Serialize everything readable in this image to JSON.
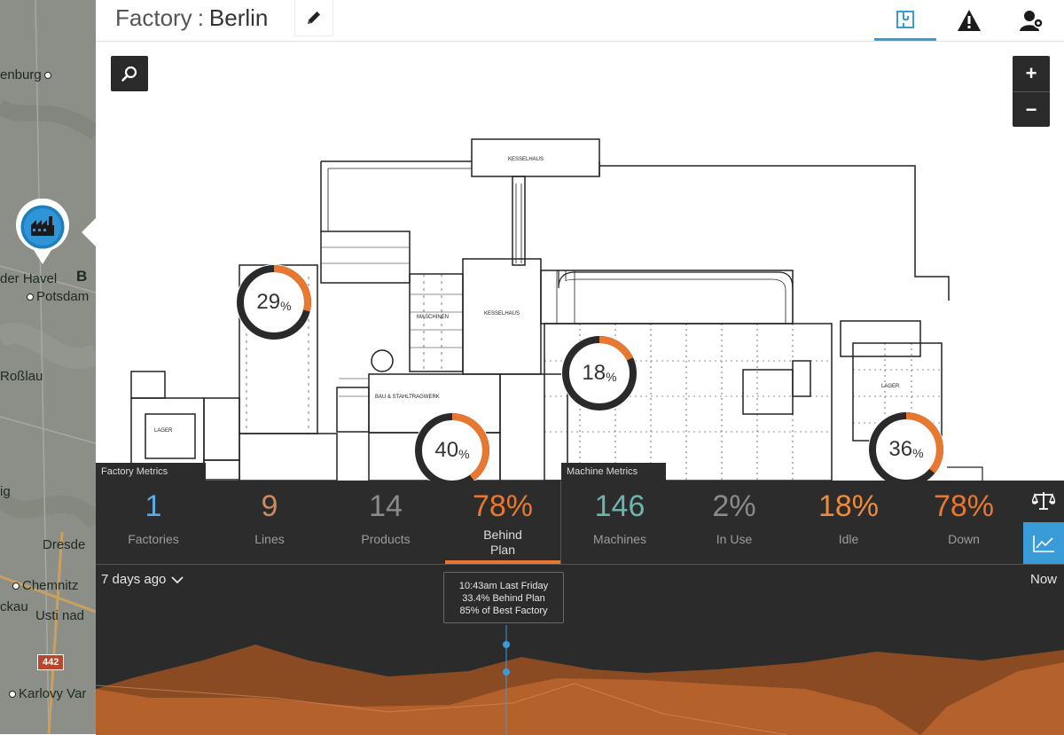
{
  "header": {
    "title_label": "Factory",
    "title_separator": ":",
    "factory_name": "Berlin"
  },
  "map": {
    "cities": [
      "enburg",
      "der Havel",
      "Potsdam",
      "Roßlau",
      "ig",
      "Dresde",
      "Chemnitz",
      "ckau",
      "Usti nad",
      "Karlovy Var"
    ],
    "city_b": "B",
    "road_badge": "442"
  },
  "zoom": {
    "in_label": "+",
    "out_label": "−"
  },
  "gauges": [
    {
      "value": 29,
      "unit": "%"
    },
    {
      "value": 18,
      "unit": "%"
    },
    {
      "value": 40,
      "unit": "%"
    },
    {
      "value": 36,
      "unit": "%"
    }
  ],
  "factory_metrics": {
    "tab_label": "Factory Metrics",
    "items": [
      {
        "value": "1",
        "label": "Factories",
        "color": "#5aaee4"
      },
      {
        "value": "9",
        "label": "Lines",
        "color": "#c98a63"
      },
      {
        "value": "14",
        "label": "Products",
        "color": "#8a8a8a"
      },
      {
        "value": "78%",
        "label": "Behind Plan",
        "color": "#e8782f"
      }
    ]
  },
  "machine_metrics": {
    "tab_label": "Machine Metrics",
    "items": [
      {
        "value": "146",
        "label": "Machines",
        "color": "#6fb3ad"
      },
      {
        "value": "2%",
        "label": "In Use",
        "color": "#8a8a8a"
      },
      {
        "value": "18%",
        "label": "Idle",
        "color": "#f08a3c"
      },
      {
        "value": "78%",
        "label": "Down",
        "color": "#e8782f"
      }
    ]
  },
  "timeline": {
    "range_label": "7 days ago",
    "now_label": "Now",
    "tooltip": {
      "line1": "10:43am Last Friday",
      "line2": "33.4% Behind Plan",
      "line3": "85% of Best Factory"
    }
  },
  "colors": {
    "accent_blue": "#3a9bd9",
    "accent_orange": "#e8782f",
    "panel_dark": "#2c2c2c"
  }
}
